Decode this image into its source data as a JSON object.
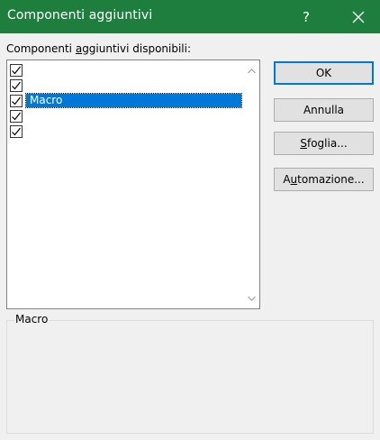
{
  "window": {
    "title": "Componenti aggiuntivi",
    "help_label": "?"
  },
  "available": {
    "label_pre": "Componenti ",
    "label_accel": "a",
    "label_post": "ggiuntivi disponibili:"
  },
  "addins": [
    {
      "label": "",
      "checked": true,
      "selected": false
    },
    {
      "label": "",
      "checked": true,
      "selected": false
    },
    {
      "label": "Macro",
      "checked": true,
      "selected": true
    },
    {
      "label": "",
      "checked": true,
      "selected": false
    },
    {
      "label": "",
      "checked": true,
      "selected": false
    }
  ],
  "buttons": {
    "ok": "OK",
    "cancel": "Annulla",
    "browse_accel": "S",
    "browse_rest": "foglia...",
    "automation_pre": "A",
    "automation_accel": "u",
    "automation_rest": "tomazione..."
  },
  "description": {
    "title": "Macro"
  },
  "colors": {
    "titlebar": "#1e7e3e",
    "selection": "#0078d7"
  }
}
